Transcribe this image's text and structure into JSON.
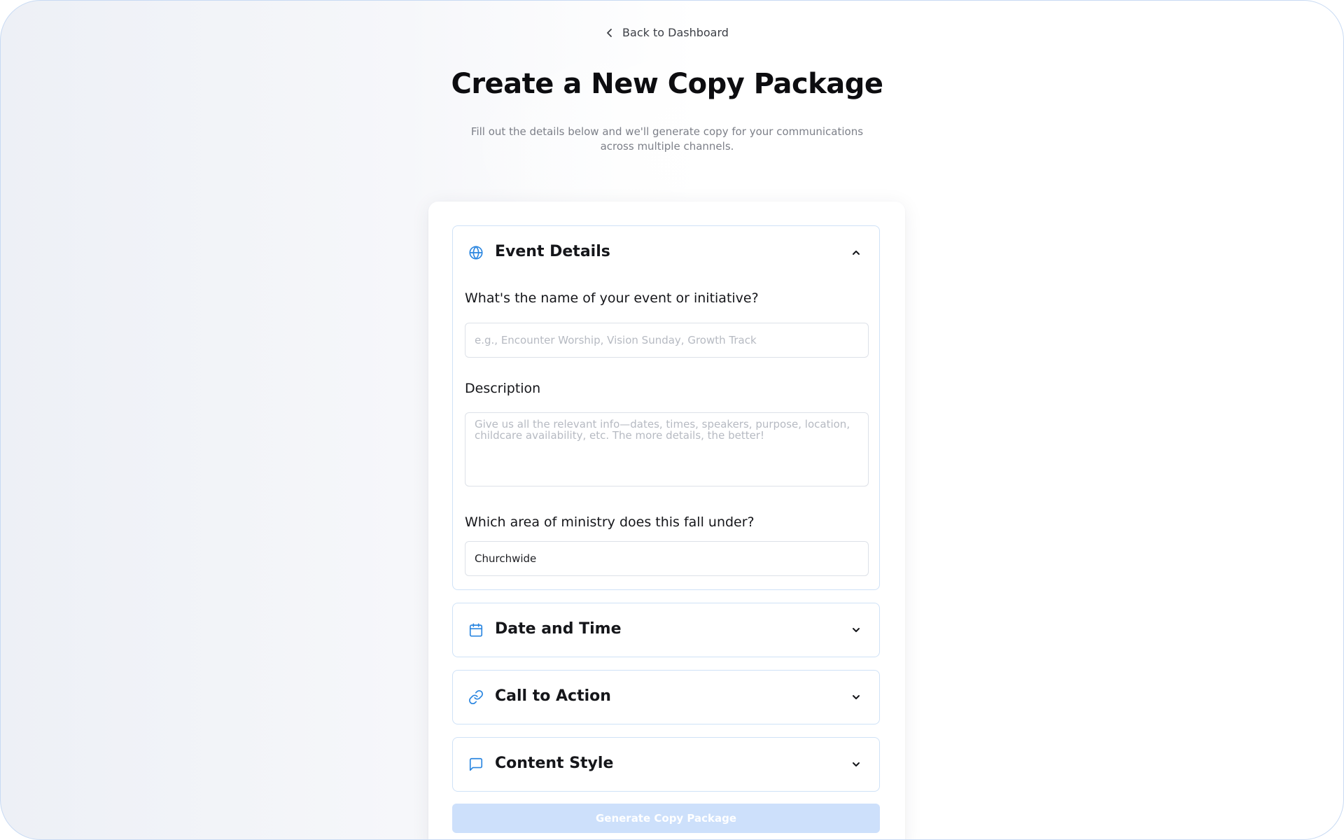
{
  "nav": {
    "back_label": "Back to Dashboard"
  },
  "header": {
    "title": "Create a New Copy Package",
    "subtitle": "Fill out the details below and we'll generate copy for your communications across multiple channels."
  },
  "sections": {
    "event_details": {
      "title": "Event Details",
      "icon": "globe-icon",
      "expanded": true,
      "fields": {
        "name": {
          "label": "What's the name of your event or initiative?",
          "value": "",
          "placeholder": "e.g., Encounter Worship, Vision Sunday, Growth Track"
        },
        "description": {
          "label": "Description",
          "value": "",
          "placeholder": "Give us all the relevant info—dates, times, speakers, purpose, location, childcare availability, etc. The more details, the better!"
        },
        "ministry_area": {
          "label": "Which area of ministry does this fall under?",
          "value": "Churchwide"
        }
      }
    },
    "date_time": {
      "title": "Date and Time",
      "icon": "calendar-icon",
      "expanded": false
    },
    "call_to_action": {
      "title": "Call to Action",
      "icon": "link-icon",
      "expanded": false
    },
    "content_style": {
      "title": "Content Style",
      "icon": "message-square-icon",
      "expanded": false
    }
  },
  "actions": {
    "generate_label": "Generate Copy Package",
    "generate_enabled": false
  },
  "colors": {
    "accent": "#2b86e0",
    "section_border": "#cfe2f7",
    "button_disabled_bg": "#cde0fb",
    "title_text": "#0d0d10",
    "muted_text": "#7d8089"
  }
}
